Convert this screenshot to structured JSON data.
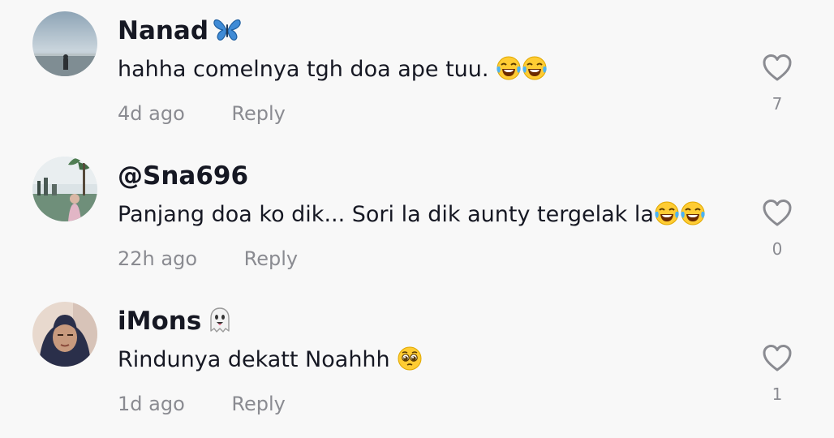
{
  "comments": [
    {
      "username": "Nanad",
      "username_badge": "butterfly-emoji",
      "text": "hahha comelnya tgh doa ape tuu.",
      "text_emojis": [
        "tears-of-joy-emoji",
        "tears-of-joy-emoji"
      ],
      "time": "4d ago",
      "reply_label": "Reply",
      "like_count": "7",
      "like_icon": "heart-outline-icon"
    },
    {
      "username": "@Sna696",
      "text": "Panjang doa ko dik... Sori la dik aunty tergelak la",
      "text_emojis": [
        "tears-of-joy-emoji",
        "tears-of-joy-emoji"
      ],
      "time": "22h ago",
      "reply_label": "Reply",
      "like_count": "0",
      "like_icon": "heart-outline-icon"
    },
    {
      "username": "iMons",
      "username_badge": "ghost-emoji",
      "text": "Rindunya dekatt Noahhh",
      "text_emojis": [
        "pleading-face-emoji"
      ],
      "time": "1d ago",
      "reply_label": "Reply",
      "like_count": "1",
      "like_icon": "heart-outline-icon"
    }
  ],
  "colors": {
    "background": "#f8f8f8",
    "primary_text": "#161823",
    "secondary_text": "#8a8b91",
    "icon_stroke": "#8a8b91"
  }
}
